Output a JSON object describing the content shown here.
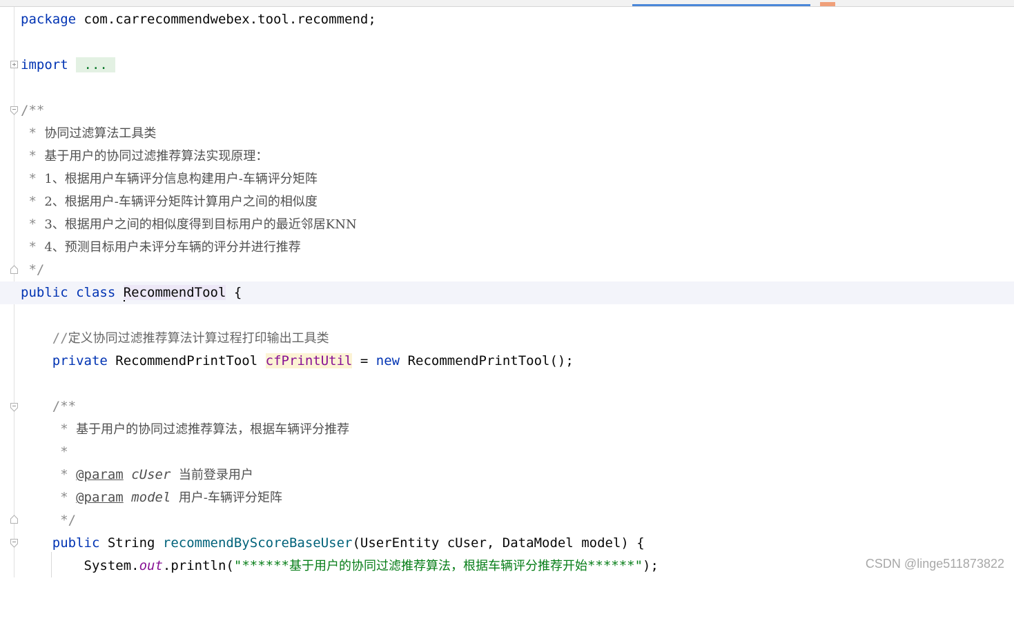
{
  "editor": {
    "lines": {
      "package_kw": "package",
      "package_name": " com.carrecommendwebex.tool.recommend;",
      "import_kw": "import",
      "import_folded": " ... ",
      "doc_open": "/**",
      "doc1_star": " * ",
      "doc1_text": "协同过滤算法工具类",
      "doc2_text": "基于用户的协同过滤推荐算法实现原理：",
      "doc3_text": "1、根据用户车辆评分信息构建用户-车辆评分矩阵",
      "doc4_text": "2、根据用户-车辆评分矩阵计算用户之间的相似度",
      "doc5_text": "3、根据用户之间的相似度得到目标用户的最近邻居KNN",
      "doc6_text": "4、预测目标用户未评分车辆的评分并进行推荐",
      "doc_close": " */",
      "class_kw": "public class ",
      "class_name": "RecommendTool",
      "class_brace": " {",
      "comment_slashes": "//",
      "comment_text": "定义协同过滤推荐算法计算过程打印输出工具类",
      "field_kw": "private",
      "field_type": " RecommendPrintTool ",
      "field_name": "cfPrintUtil",
      "field_eq": " = ",
      "field_new": "new",
      "field_ctor": " RecommendPrintTool();",
      "mdoc_open": "/**",
      "mdoc1_text": "基于用户的协同过滤推荐算法，根据车辆评分推荐",
      "mdoc_star": " *",
      "param_tag": "@param",
      "param1_name": "cUser",
      "param1_desc": "当前登录用户",
      "param2_name": "model",
      "param2_desc": "用户-车辆评分矩阵",
      "mdoc_close": " */",
      "method_kw": "public",
      "method_ret": " String ",
      "method_name": "recommendByScoreBaseUser",
      "method_params": "(UserEntity cUser, DataModel model) {",
      "sys": "System.",
      "sys_out": "out",
      "sys_println": ".println(",
      "str_quote_open": "\"******",
      "str_text": "基于用户的协同过滤推荐算法，根据车辆评分推荐开始",
      "str_quote_close": "******\"",
      "sys_end": ");"
    }
  },
  "watermark": "CSDN @linge511873822",
  "colors": {
    "keyword": "#0033b3",
    "string": "#067d17",
    "comment": "#8c8c8c",
    "field": "#871094",
    "method": "#00627a",
    "current_line": "#f3f4fa"
  }
}
